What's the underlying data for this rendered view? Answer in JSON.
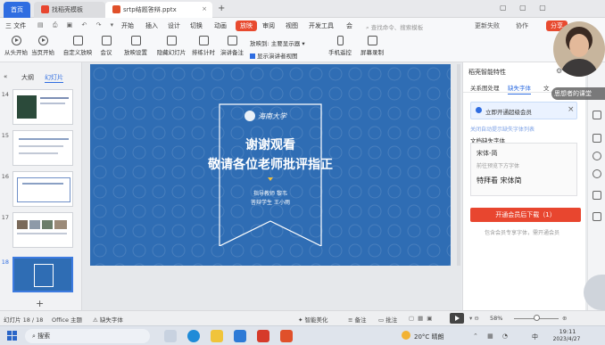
{
  "tabs": [
    {
      "label": "首页"
    },
    {
      "label": "找稻壳模板"
    },
    {
      "label": "srtp结题答辩.pptx"
    }
  ],
  "menu": {
    "file": "三 文件",
    "items": [
      "开始",
      "插入",
      "设计",
      "切换",
      "动画",
      "放映",
      "审阅",
      "视图",
      "开发工具",
      "会"
    ],
    "active": "放映",
    "search_placeholder": "查找命令、搜索模板",
    "right": [
      "更新失败",
      "协作",
      "分享"
    ]
  },
  "ribbon": {
    "buttons": [
      "从头开始",
      "当页开始",
      "自定义放映",
      "会议",
      "放映设置",
      "隐藏幻灯片",
      "排练计时",
      "演讲备注",
      "手机遥控",
      "屏幕录制"
    ],
    "display_label": "放映到:",
    "display_value": "主要显示器",
    "presenter_view": "显示演讲者视图"
  },
  "left_panel": {
    "tabs": [
      "大纲",
      "幻灯片"
    ],
    "slide_numbers": [
      "14",
      "15",
      "16",
      "17",
      "18"
    ],
    "add_label": "+"
  },
  "slide": {
    "logo_text": "海南大学",
    "title_line1": "谢谢观看",
    "title_line2": "敬请各位老师批评指正",
    "advisor": "指导教师  黎韦",
    "presenter": "答辩学生  王小雨"
  },
  "right_panel": {
    "header": "稻壳智能特性",
    "tabs": [
      "关系图处理",
      "缺失字体",
      "文"
    ],
    "active_tab": "缺失字体",
    "vip_text": "立即开通超级会员",
    "close_icon": "×",
    "link_text": "关闭自动提示缺失字体列表",
    "section_title": "文档缺失字体",
    "font_name": "宋体-简",
    "font_hint": "前往预览下方字体",
    "font_sample": "特拜看 宋体简",
    "download_label": "开通会员后下载（1）",
    "footer_text": "包含会员专享字体，需开通会员"
  },
  "overlay": {
    "caption": "思想者的课堂"
  },
  "status": {
    "slide_count": "幻灯片 18 / 18",
    "theme": "Office 主题",
    "missing_font": "缺失字体",
    "smart_beautify": "智能美化",
    "notes": "备注",
    "comments": "批注",
    "zoom": "58%"
  },
  "taskbar": {
    "search": "搜索",
    "weather": "20°C 晴朗",
    "ime": "中",
    "time": "19:11",
    "date": "2023/4/27"
  },
  "colors": {
    "accent_red": "#e84a2f",
    "slide_blue": "#2f6db4",
    "brand_blue": "#2f6de1"
  }
}
